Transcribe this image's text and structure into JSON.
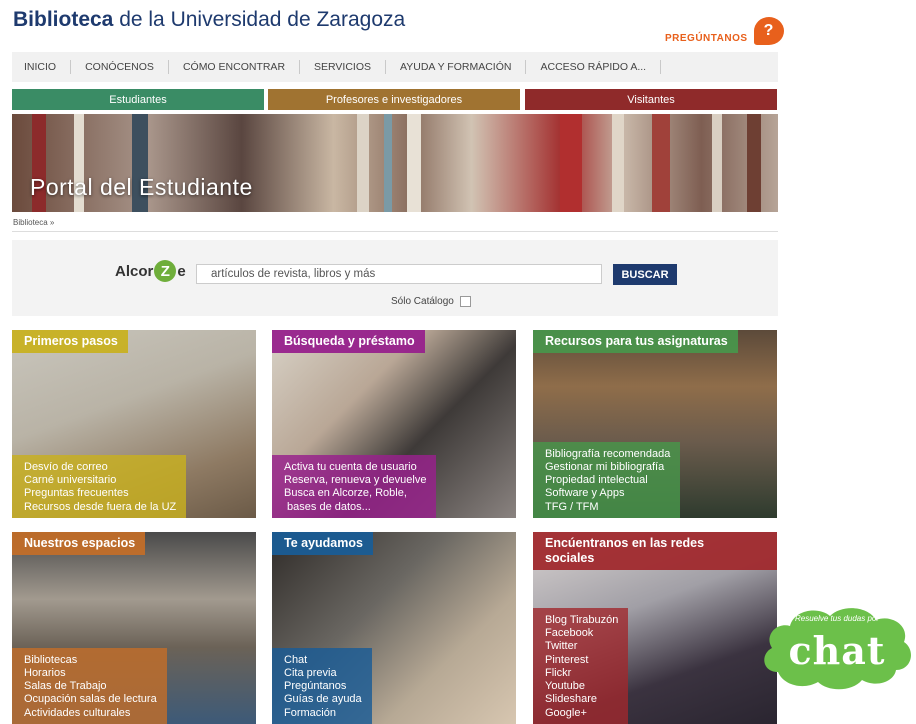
{
  "header": {
    "title_bold": "Biblioteca",
    "title_rest": " de la Universidad de Zaragoza",
    "ask_label": "PREGÚNTANOS",
    "ask_icon_text": "?",
    "ask_icon": "question-bubble-icon"
  },
  "nav": {
    "items": [
      {
        "label": "INICIO"
      },
      {
        "label": "CONÓCENOS"
      },
      {
        "label": "CÓMO ENCONTRAR"
      },
      {
        "label": "SERVICIOS"
      },
      {
        "label": "AYUDA Y FORMACIÓN"
      },
      {
        "label": "ACCESO RÁPIDO A..."
      }
    ]
  },
  "audience_tabs": [
    {
      "label": "Estudiantes",
      "color": "#3a8c65"
    },
    {
      "label": "Profesores e investigadores",
      "color": "#a07331"
    },
    {
      "label": "Visitantes",
      "color": "#8f2a2a"
    }
  ],
  "banner": {
    "title": "Portal del Estudiante"
  },
  "breadcrumb": "Biblioteca »",
  "search": {
    "logo_a": "Alcor",
    "logo_z": "Z",
    "logo_e": "e",
    "placeholder": "artículos de revista, libros y más",
    "button": "BUSCAR",
    "checkbox_label": "Sólo Catálogo",
    "checkbox_checked": false
  },
  "cards": [
    {
      "title": "Primeros pasos",
      "color": "#c8b01e",
      "links": [
        "Desvío de correo",
        "Carné universitario",
        "Preguntas frecuentes",
        "Recursos desde fuera de la UZ"
      ]
    },
    {
      "title": "Búsqueda y préstamo",
      "color": "#97218c",
      "links": [
        "Activa tu cuenta de usuario",
        "Reserva, renueva y devuelve",
        "Busca en Alcorze, Roble,",
        " bases de datos..."
      ]
    },
    {
      "title": "Recursos para tus asignaturas",
      "color": "#48964b",
      "links": [
        "Bibliografía recomendada",
        "Gestionar mi bibliografía",
        "Propiedad intelectual",
        "Software y Apps",
        "TFG / TFM"
      ]
    },
    {
      "title": "Nuestros espacios",
      "color": "#c46e28",
      "links": [
        "Bibliotecas",
        "Horarios",
        "Salas de Trabajo",
        "Ocupación salas de lectura",
        "Actividades culturales"
      ]
    },
    {
      "title": "Te ayudamos",
      "color": "#1a5c96",
      "links": [
        "Chat",
        "Cita previa",
        "Pregúntanos",
        "Guías de ayuda",
        "Formación"
      ]
    },
    {
      "title": "Encúentranos en las redes sociales",
      "title_line1": "Encúentranos en las redes",
      "title_line2": "sociales",
      "color": "#a0282d",
      "links": [
        "Blog Tirabuzón",
        "Facebook",
        "Twitter",
        "Pinterest",
        "Flickr",
        "Youtube",
        "Slideshare",
        "Google+"
      ]
    }
  ],
  "chat_badge": {
    "subtitle": "Resuelve tus dudas por",
    "word": "chat",
    "color": "#6cc04a"
  }
}
